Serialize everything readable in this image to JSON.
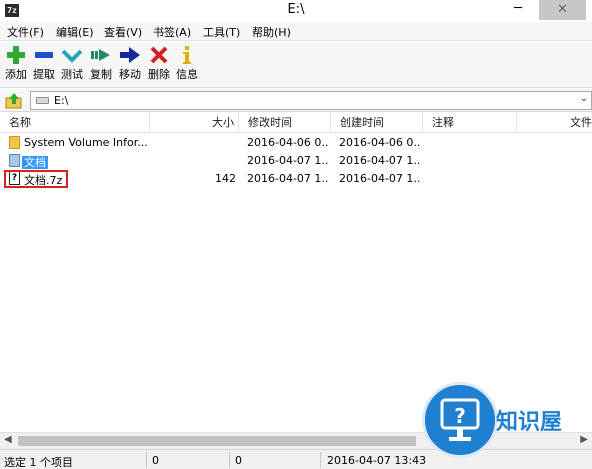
{
  "window": {
    "title": "E:\\",
    "app_icon_text": "7z",
    "minimize_glyph": "─",
    "close_glyph": "✕"
  },
  "menu": [
    "文件(F)",
    "编辑(E)",
    "查看(V)",
    "书签(A)",
    "工具(T)",
    "帮助(H)"
  ],
  "toolbar": {
    "add": "添加",
    "extract": "提取",
    "test": "测试",
    "copy": "复制",
    "move": "移动",
    "delete": "删除",
    "info": "信息"
  },
  "address": {
    "path": "E:\\",
    "dropdown_glyph": "⌄"
  },
  "columns": [
    "名称",
    "大小",
    "修改时间",
    "创建时间",
    "注释",
    "文件"
  ],
  "rows": [
    {
      "name": "System Volume Infor...",
      "size": "",
      "modified": "2016-04-06 0...",
      "created": "2016-04-06 0..."
    },
    {
      "name": "文档",
      "size": "",
      "modified": "2016-04-07 1...",
      "created": "2016-04-07 1..."
    },
    {
      "name": "文档.7z",
      "size": "142",
      "modified": "2016-04-07 1...",
      "created": "2016-04-07 1..."
    }
  ],
  "scrollbar": {
    "left_glyph": "◀",
    "right_glyph": "▶"
  },
  "status": {
    "selection": "选定 1 个项目",
    "size": "0",
    "packed": "0",
    "datetime": "2016-04-07 13:43"
  },
  "watermark": {
    "text": "知识屋",
    "icon_glyph": "?"
  },
  "colors": {
    "add": "#2eaa2e",
    "extract": "#2050c8",
    "test": "#2aa4b8",
    "copy": "#1f8a6a",
    "move": "#142a9a",
    "delete": "#d02020",
    "info": "#e0b000",
    "selection": "#3399ff",
    "highlight_box": "#e02020",
    "watermark": "#1f7fd1"
  }
}
